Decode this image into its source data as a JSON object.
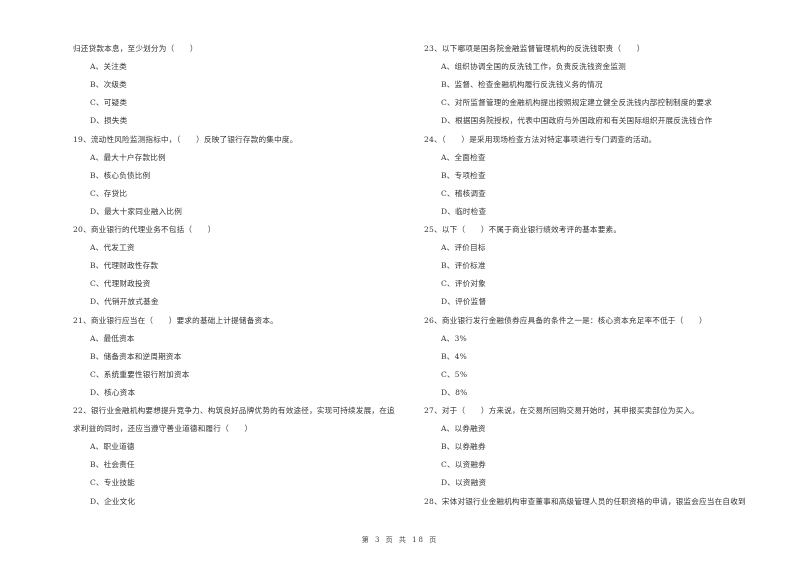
{
  "left_column": {
    "lines": [
      {
        "kind": "stem",
        "text": "归还贷款本息，至少划分为（　　）"
      },
      {
        "kind": "option",
        "text": "A、关注类"
      },
      {
        "kind": "option",
        "text": "B、次级类"
      },
      {
        "kind": "option",
        "text": "C、可疑类"
      },
      {
        "kind": "option",
        "text": "D、损失类"
      },
      {
        "kind": "stem",
        "text": "19、流动性风险监测指标中，（　　）反映了银行存款的集中度。"
      },
      {
        "kind": "option",
        "text": "A、最大十户存款比例"
      },
      {
        "kind": "option",
        "text": "B、核心负债比例"
      },
      {
        "kind": "option",
        "text": "C、存贷比"
      },
      {
        "kind": "option",
        "text": "D、最大十家同业融入比例"
      },
      {
        "kind": "stem",
        "text": "20、商业银行的代理业务不包括（　　）"
      },
      {
        "kind": "option",
        "text": "A、代发工资"
      },
      {
        "kind": "option",
        "text": "B、代理财政性存款"
      },
      {
        "kind": "option",
        "text": "C、代理财政投资"
      },
      {
        "kind": "option",
        "text": "D、代销开放式基金"
      },
      {
        "kind": "stem",
        "text": "21、商业银行应当在（　　）要求的基础上计提储备资本。"
      },
      {
        "kind": "option",
        "text": "A、最低资本"
      },
      {
        "kind": "option",
        "text": "B、储备资本和逆周期资本"
      },
      {
        "kind": "option",
        "text": "C、系统重要性银行附加资本"
      },
      {
        "kind": "option",
        "text": "D、核心资本"
      },
      {
        "kind": "stem",
        "text": "22、银行业金融机构要想提升竞争力、构筑良好品牌优势的有效途径，实现可持续发展，在追"
      },
      {
        "kind": "stem",
        "text": "求利益的同时，还应当遵守善业道德和履行（　　）"
      },
      {
        "kind": "option",
        "text": "A、职业道德"
      },
      {
        "kind": "option",
        "text": "B、社会责任"
      },
      {
        "kind": "option",
        "text": "C、专业技能"
      },
      {
        "kind": "option",
        "text": "D、企业文化"
      }
    ]
  },
  "right_column": {
    "lines": [
      {
        "kind": "stem",
        "text": "23、以下哪项是国务院金融监督管理机构的反洗钱职责（　　）"
      },
      {
        "kind": "option",
        "text": "A、组织协调全国的反洗钱工作，负责反洗钱资金监测"
      },
      {
        "kind": "option",
        "text": "B、监督、检查金融机构履行反洗钱义务的情况"
      },
      {
        "kind": "option",
        "text": "C、对所监督管理的金融机构提出按照规定建立健全反洗钱内部控制制度的要求"
      },
      {
        "kind": "option",
        "text": "D、根据国务院授权，代表中国政府与外国政府和有关国际组织开展反洗钱合作"
      },
      {
        "kind": "stem",
        "text": "24、（　　）是采用现场检查方法对特定事项进行专门调查的活动。"
      },
      {
        "kind": "option",
        "text": "A、全面检查"
      },
      {
        "kind": "option",
        "text": "B、专项检查"
      },
      {
        "kind": "option",
        "text": "C、稽核调查"
      },
      {
        "kind": "option",
        "text": "D、临时检查"
      },
      {
        "kind": "stem",
        "text": "25、以下（　　）不属于商业银行绩效考评的基本要素。"
      },
      {
        "kind": "option",
        "text": "A、评价目标"
      },
      {
        "kind": "option",
        "text": "B、评价标准"
      },
      {
        "kind": "option",
        "text": "C、评价对象"
      },
      {
        "kind": "option",
        "text": "D、评价监督"
      },
      {
        "kind": "stem",
        "text": "26、商业银行发行金融债券应具备的条件之一是：核心资本充足率不低于（　　）"
      },
      {
        "kind": "option",
        "text": "A、3%"
      },
      {
        "kind": "option",
        "text": "B、4%"
      },
      {
        "kind": "option",
        "text": "C、5%"
      },
      {
        "kind": "option",
        "text": "D、8%"
      },
      {
        "kind": "stem",
        "text": "27、对于（　　）方来说，在交易所回购交易开始时，其申报买卖部位为买入。"
      },
      {
        "kind": "option",
        "text": "A、以券融资"
      },
      {
        "kind": "option",
        "text": "B、以券融券"
      },
      {
        "kind": "option",
        "text": "C、以资融券"
      },
      {
        "kind": "option",
        "text": "D、以资融资"
      },
      {
        "kind": "stem",
        "text": "28、宋体对银行业金融机构审查董事和高级管理人员的任职资格的申请，银监会应当在自收到"
      }
    ]
  },
  "footer": {
    "page_label": "第 3 页 共 18 页"
  }
}
